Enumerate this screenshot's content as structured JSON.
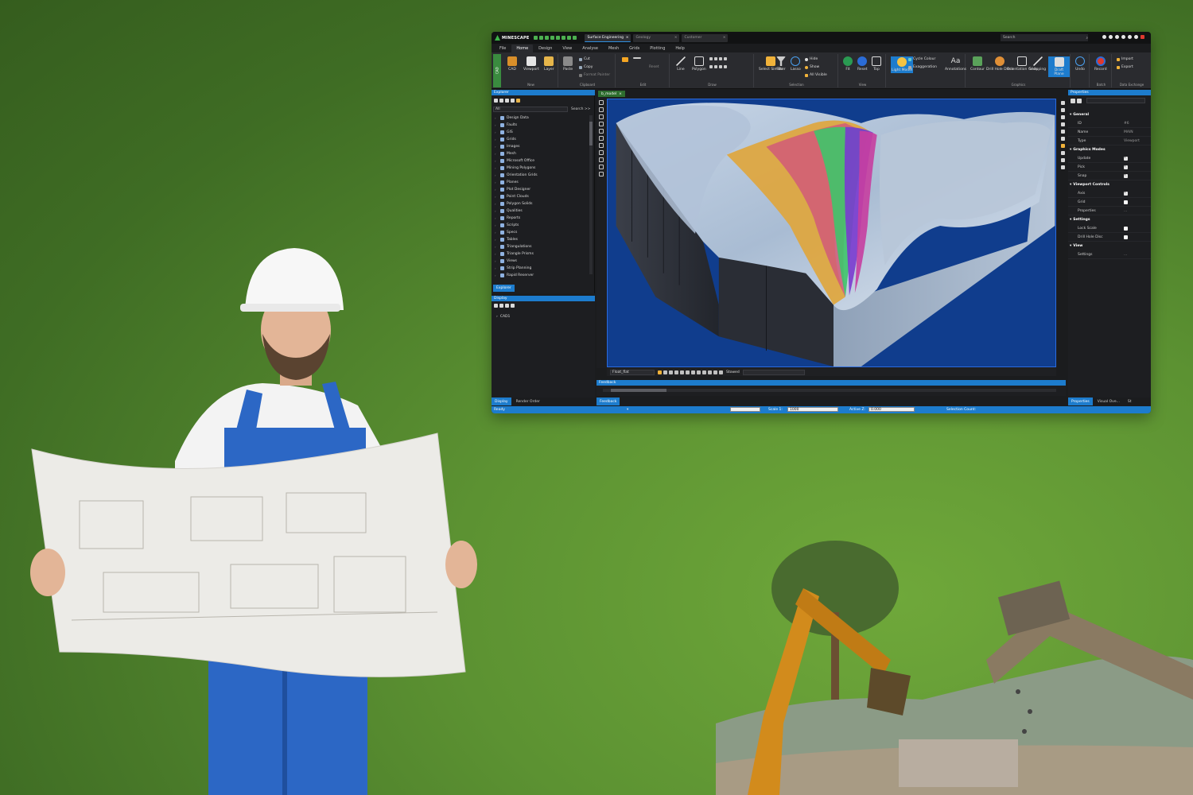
{
  "app": {
    "name": "MINESCAPE",
    "doc_tabs": [
      "Surface Engineering",
      "Geology",
      "Customer"
    ],
    "search_placeholder": "Search",
    "menu": [
      "File",
      "Home",
      "Design",
      "View",
      "Analyse",
      "Mesh",
      "Grids",
      "Plotting",
      "Help"
    ],
    "cad_tag": "CAD",
    "ribbon": {
      "groups": [
        {
          "name": "New",
          "buttons": [
            "CAD",
            "Viewport",
            "Layer"
          ]
        },
        {
          "name": "Clipboard",
          "buttons": [
            "Paste"
          ],
          "items": [
            "Cut",
            "Copy",
            "Format Painter"
          ]
        },
        {
          "name": "Edit",
          "items": [
            "Reset"
          ]
        },
        {
          "name": "Draw",
          "buttons": [
            "Line",
            "Polygon"
          ]
        },
        {
          "name": "Selection",
          "buttons": [
            "Select Similar",
            "Filter",
            "Lasso"
          ],
          "items": [
            "Hide",
            "Show",
            "All Visible"
          ]
        },
        {
          "name": "View",
          "buttons": [
            "Fit",
            "Reset",
            "Top"
          ]
        },
        {
          "name": "",
          "buttons": [
            "Light Model",
            "Annotations"
          ],
          "items": [
            "Cycle Colour",
            "Exaggeration"
          ]
        },
        {
          "name": "Graphics",
          "buttons": [
            "Contour",
            "Drill Hole Discs",
            "Orientation Grids",
            "Snapping",
            "Draft Plane"
          ]
        },
        {
          "name": "",
          "buttons": [
            "Undo"
          ]
        },
        {
          "name": "Batch",
          "buttons": [
            "Record"
          ]
        },
        {
          "name": "Data Exchange",
          "items": [
            "Import",
            "Export"
          ]
        }
      ]
    },
    "explorer": {
      "title": "Explorer",
      "filter": "All",
      "search_label": "Search >>",
      "items": [
        "Design Data",
        "Faults",
        "GIS",
        "Grids",
        "Images",
        "Mesh",
        "Microsoft Office",
        "Mining Polygons",
        "Orientation Grids",
        "Planes",
        "Plot Designer",
        "Point Clouds",
        "Polygon Solids",
        "Qualities",
        "Reports",
        "Scripts",
        "Specs",
        "Tables",
        "Triangulations",
        "Triangle Prisms",
        "Views",
        "Strip Planning",
        "Rapid Reserver"
      ],
      "tab": "Explorer"
    },
    "display": {
      "title": "Display",
      "items": [
        "CAD1"
      ]
    },
    "bottom_tabs": [
      "Display",
      "Render Order"
    ],
    "viewport": {
      "tab": "b_model",
      "mode_select": "Float_flat",
      "label": "Stowed"
    },
    "feedback": {
      "title": "Feedback",
      "tab": "Feedback"
    },
    "properties": {
      "title": "Properties",
      "groups": [
        {
          "name": "General",
          "rows": [
            {
              "label": "ID",
              "value": "#6"
            },
            {
              "label": "Name",
              "value": "MAIN"
            },
            {
              "label": "Type",
              "value": "Viewport"
            }
          ]
        },
        {
          "name": "Graphics Modes",
          "rows": [
            {
              "label": "Update",
              "check": true
            },
            {
              "label": "Pick",
              "check": true
            },
            {
              "label": "Snap",
              "check": true
            }
          ]
        },
        {
          "name": "Viewport Controls",
          "rows": [
            {
              "label": "Axis",
              "check": true
            },
            {
              "label": "Grid",
              "check": false
            },
            {
              "label": "Properties",
              "value": "..."
            }
          ]
        },
        {
          "name": "Settings",
          "rows": [
            {
              "label": "Lock Scale",
              "check": false
            },
            {
              "label": "Drill Hole Disc",
              "check": false
            }
          ]
        },
        {
          "name": "View",
          "rows": [
            {
              "label": "Settings",
              "value": "..."
            }
          ]
        }
      ],
      "tabs": [
        "Properties",
        "Visual Ove...",
        "St"
      ]
    },
    "statusbar": {
      "ready": "Ready",
      "scale_label": "Scale 1:",
      "scale_value": "1000",
      "active_label": "Active Z:",
      "active_value": "0.000",
      "selection_label": "Selection Count:"
    },
    "colors": {
      "accent": "#1d7ccd",
      "brand_green": "#3db34a",
      "viewport_bg": "#103d8d"
    }
  }
}
